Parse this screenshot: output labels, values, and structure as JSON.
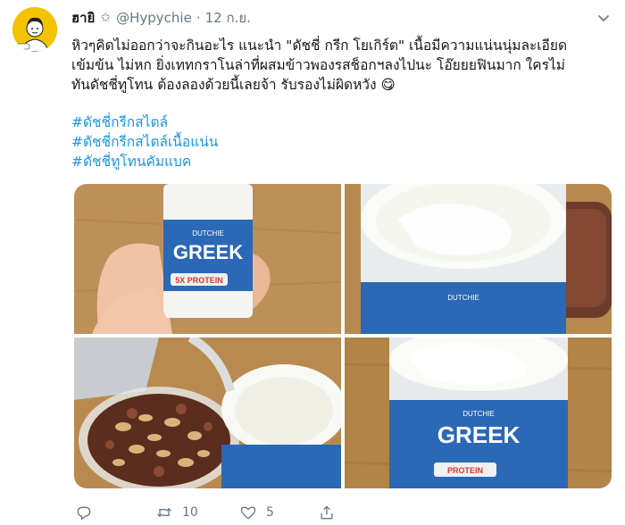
{
  "tweet": {
    "display_name": "ฮายิ",
    "verified_glyph": "✩",
    "handle": "@Hypychie",
    "separator": "·",
    "timestamp": "12 ก.ย.",
    "text_lines": [
      "หิวๆคิดไม่ออกว่าจะกินอะไร แนะนำ \"ดัชชี่ กรีก โยเกิร์ต\" เนื้อมีความแน่นนุ่มละเอียด",
      "เข้มข้น ไม่หก ยิ่งเททกราโนล่าที่ผสมข้าวพองรสช็อกฯลงไปนะ โอ๊ยยยฟินมาก ใครไม่",
      "ทันดัชชี่ทูโทน ต้องลองด้วยนี้เลยจ้า รับรองไม่ผิดหวัง 😋"
    ],
    "hashtags": [
      "#ดัชชี่กรีกสไตล์",
      "#ดัชชี่กรีกสไตล์เนื้อแน่น",
      "#ดัชชี่ทูโทนคัมแบค"
    ],
    "photos": [
      {
        "brand": "DUTCHIE",
        "product": "GREEK",
        "claim": "5X PROTEIN"
      },
      {
        "brand": "DUTCHIE"
      },
      {},
      {
        "brand": "DUTCHIE",
        "product": "GREEK",
        "claim": "PROTEIN"
      }
    ],
    "actions": {
      "reply_count": "",
      "retweet_count": "10",
      "like_count": "5",
      "share_count": ""
    },
    "icons": [
      "avatar",
      "caret-down-icon",
      "reply-icon",
      "retweet-icon",
      "like-icon",
      "share-icon"
    ],
    "colors": {
      "link": "#1b95e0",
      "muted": "#657786",
      "text": "#14171a"
    }
  }
}
